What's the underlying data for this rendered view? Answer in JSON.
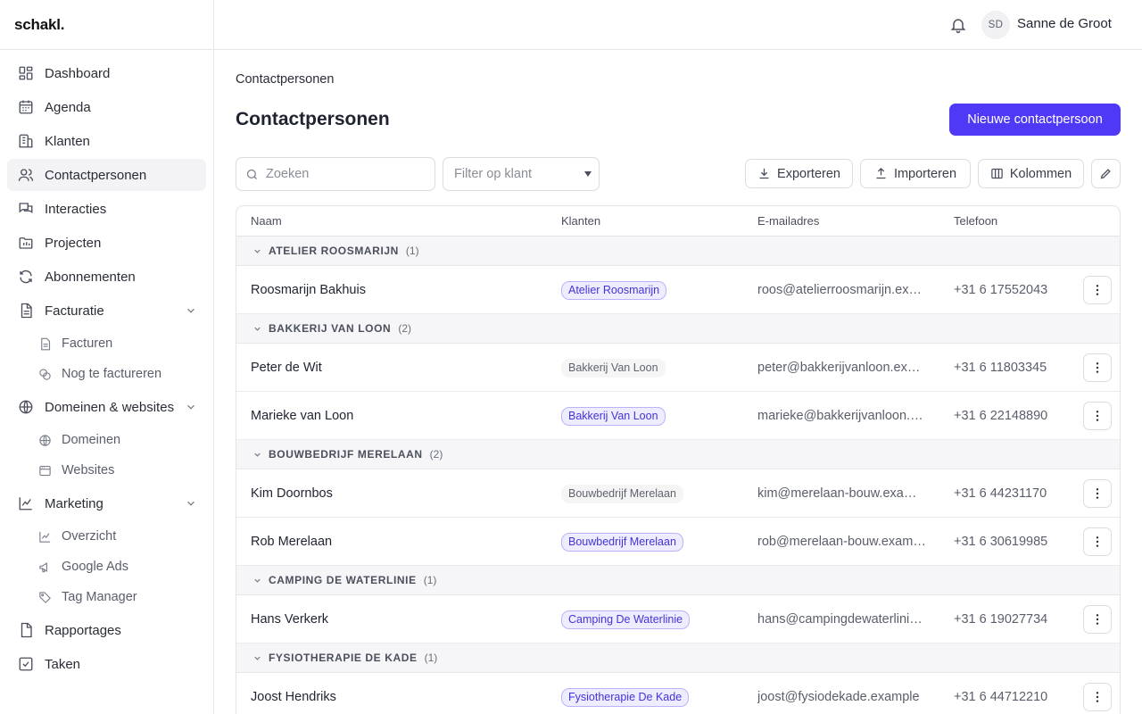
{
  "brand": "schakl.",
  "user": {
    "initials": "SD",
    "name": "Sanne de Groot"
  },
  "sidebar": {
    "items": [
      {
        "label": "Dashboard",
        "icon": "dashboard-icon"
      },
      {
        "label": "Agenda",
        "icon": "calendar-icon"
      },
      {
        "label": "Klanten",
        "icon": "building-icon"
      },
      {
        "label": "Contactpersonen",
        "icon": "users-icon",
        "active": true
      },
      {
        "label": "Interacties",
        "icon": "chat-icon"
      },
      {
        "label": "Projecten",
        "icon": "folder-icon"
      },
      {
        "label": "Abonnementen",
        "icon": "refresh-icon"
      },
      {
        "label": "Facturatie",
        "icon": "document-icon",
        "expanded": true,
        "children": [
          {
            "label": "Facturen",
            "icon": "file-icon"
          },
          {
            "label": "Nog te factureren",
            "icon": "coins-icon"
          }
        ]
      },
      {
        "label": "Domeinen & websites",
        "icon": "globe-icon",
        "expanded": true,
        "children": [
          {
            "label": "Domeinen",
            "icon": "globe-icon"
          },
          {
            "label": "Websites",
            "icon": "browser-icon"
          }
        ]
      },
      {
        "label": "Marketing",
        "icon": "chart-line-icon",
        "expanded": true,
        "children": [
          {
            "label": "Overzicht",
            "icon": "chart-line-icon"
          },
          {
            "label": "Google Ads",
            "icon": "megaphone-icon"
          },
          {
            "label": "Tag Manager",
            "icon": "tag-icon"
          }
        ]
      },
      {
        "label": "Rapportages",
        "icon": "report-icon"
      },
      {
        "label": "Taken",
        "icon": "checkbox-icon"
      }
    ]
  },
  "breadcrumb": "Contactpersonen",
  "page_title": "Contactpersonen",
  "actions": {
    "new_contact": "Nieuwe contactpersoon"
  },
  "toolbar": {
    "search_placeholder": "Zoeken",
    "filter_placeholder": "Filter op klant",
    "export": "Exporteren",
    "import": "Importeren",
    "columns": "Kolommen"
  },
  "table": {
    "columns": [
      "Naam",
      "Klanten",
      "E-mailadres",
      "Telefoon"
    ],
    "groups": [
      {
        "name": "ATELIER ROOSMARIJN",
        "count": "(1)",
        "rows": [
          {
            "name": "Roosmarijn Bakhuis",
            "client": "Atelier Roosmarijn",
            "client_style": "tinted",
            "email": "roos@atelierroosmarijn.example",
            "phone": "+31 6 17552043"
          }
        ]
      },
      {
        "name": "BAKKERIJ VAN LOON",
        "count": "(2)",
        "rows": [
          {
            "name": "Peter de Wit",
            "client": "Bakkerij Van Loon",
            "client_style": "plain",
            "email": "peter@bakkerijvanloon.example",
            "phone": "+31 6 11803345"
          },
          {
            "name": "Marieke van Loon",
            "client": "Bakkerij Van Loon",
            "client_style": "tinted",
            "email": "marieke@bakkerijvanloon.example",
            "phone": "+31 6 22148890"
          }
        ]
      },
      {
        "name": "BOUWBEDRIJF MERELAAN",
        "count": "(2)",
        "rows": [
          {
            "name": "Kim Doornbos",
            "client": "Bouwbedrijf Merelaan",
            "client_style": "plain",
            "email": "kim@merelaan-bouw.example",
            "phone": "+31 6 44231170"
          },
          {
            "name": "Rob Merelaan",
            "client": "Bouwbedrijf Merelaan",
            "client_style": "tinted",
            "email": "rob@merelaan-bouw.example",
            "phone": "+31 6 30619985"
          }
        ]
      },
      {
        "name": "CAMPING DE WATERLINIE",
        "count": "(1)",
        "rows": [
          {
            "name": "Hans Verkerk",
            "client": "Camping De Waterlinie",
            "client_style": "tinted",
            "email": "hans@campingdewaterlinie.example",
            "phone": "+31 6 19027734"
          }
        ]
      },
      {
        "name": "FYSIOTHERAPIE DE KADE",
        "count": "(1)",
        "rows": [
          {
            "name": "Joost Hendriks",
            "client": "Fysiotherapie De Kade",
            "client_style": "tinted",
            "email": "joost@fysiodekade.example",
            "phone": "+31 6 44712210"
          }
        ]
      }
    ]
  },
  "colors": {
    "accent": "#4f39f6",
    "badge_bg": "#eeecff",
    "badge_border": "#b9b3f7"
  }
}
